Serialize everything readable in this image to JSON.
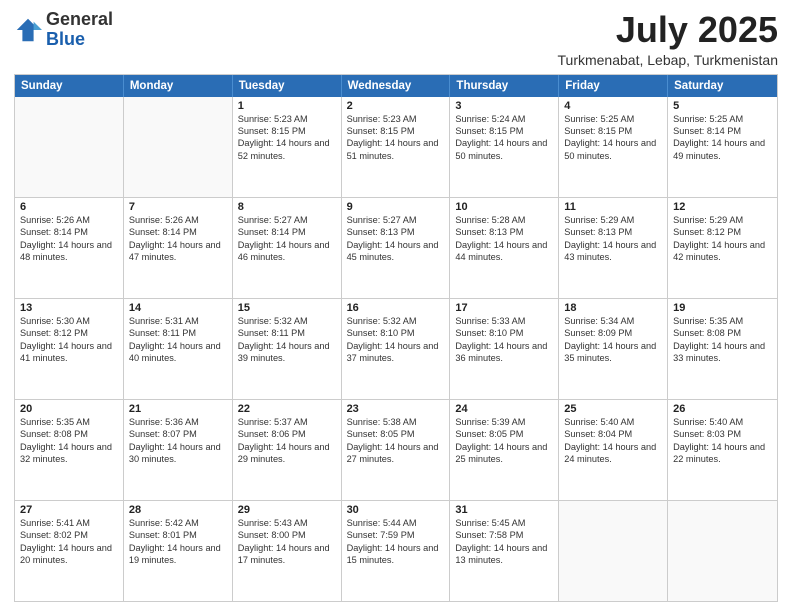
{
  "header": {
    "logo": {
      "general": "General",
      "blue": "Blue"
    },
    "title": "July 2025",
    "location": "Turkmenabat, Lebap, Turkmenistan"
  },
  "calendar": {
    "days": [
      "Sunday",
      "Monday",
      "Tuesday",
      "Wednesday",
      "Thursday",
      "Friday",
      "Saturday"
    ],
    "rows": [
      [
        {
          "day": "",
          "empty": true
        },
        {
          "day": "",
          "empty": true
        },
        {
          "day": "1",
          "sunrise": "Sunrise: 5:23 AM",
          "sunset": "Sunset: 8:15 PM",
          "daylight": "Daylight: 14 hours and 52 minutes."
        },
        {
          "day": "2",
          "sunrise": "Sunrise: 5:23 AM",
          "sunset": "Sunset: 8:15 PM",
          "daylight": "Daylight: 14 hours and 51 minutes."
        },
        {
          "day": "3",
          "sunrise": "Sunrise: 5:24 AM",
          "sunset": "Sunset: 8:15 PM",
          "daylight": "Daylight: 14 hours and 50 minutes."
        },
        {
          "day": "4",
          "sunrise": "Sunrise: 5:25 AM",
          "sunset": "Sunset: 8:15 PM",
          "daylight": "Daylight: 14 hours and 50 minutes."
        },
        {
          "day": "5",
          "sunrise": "Sunrise: 5:25 AM",
          "sunset": "Sunset: 8:14 PM",
          "daylight": "Daylight: 14 hours and 49 minutes."
        }
      ],
      [
        {
          "day": "6",
          "sunrise": "Sunrise: 5:26 AM",
          "sunset": "Sunset: 8:14 PM",
          "daylight": "Daylight: 14 hours and 48 minutes."
        },
        {
          "day": "7",
          "sunrise": "Sunrise: 5:26 AM",
          "sunset": "Sunset: 8:14 PM",
          "daylight": "Daylight: 14 hours and 47 minutes."
        },
        {
          "day": "8",
          "sunrise": "Sunrise: 5:27 AM",
          "sunset": "Sunset: 8:14 PM",
          "daylight": "Daylight: 14 hours and 46 minutes."
        },
        {
          "day": "9",
          "sunrise": "Sunrise: 5:27 AM",
          "sunset": "Sunset: 8:13 PM",
          "daylight": "Daylight: 14 hours and 45 minutes."
        },
        {
          "day": "10",
          "sunrise": "Sunrise: 5:28 AM",
          "sunset": "Sunset: 8:13 PM",
          "daylight": "Daylight: 14 hours and 44 minutes."
        },
        {
          "day": "11",
          "sunrise": "Sunrise: 5:29 AM",
          "sunset": "Sunset: 8:13 PM",
          "daylight": "Daylight: 14 hours and 43 minutes."
        },
        {
          "day": "12",
          "sunrise": "Sunrise: 5:29 AM",
          "sunset": "Sunset: 8:12 PM",
          "daylight": "Daylight: 14 hours and 42 minutes."
        }
      ],
      [
        {
          "day": "13",
          "sunrise": "Sunrise: 5:30 AM",
          "sunset": "Sunset: 8:12 PM",
          "daylight": "Daylight: 14 hours and 41 minutes."
        },
        {
          "day": "14",
          "sunrise": "Sunrise: 5:31 AM",
          "sunset": "Sunset: 8:11 PM",
          "daylight": "Daylight: 14 hours and 40 minutes."
        },
        {
          "day": "15",
          "sunrise": "Sunrise: 5:32 AM",
          "sunset": "Sunset: 8:11 PM",
          "daylight": "Daylight: 14 hours and 39 minutes."
        },
        {
          "day": "16",
          "sunrise": "Sunrise: 5:32 AM",
          "sunset": "Sunset: 8:10 PM",
          "daylight": "Daylight: 14 hours and 37 minutes."
        },
        {
          "day": "17",
          "sunrise": "Sunrise: 5:33 AM",
          "sunset": "Sunset: 8:10 PM",
          "daylight": "Daylight: 14 hours and 36 minutes."
        },
        {
          "day": "18",
          "sunrise": "Sunrise: 5:34 AM",
          "sunset": "Sunset: 8:09 PM",
          "daylight": "Daylight: 14 hours and 35 minutes."
        },
        {
          "day": "19",
          "sunrise": "Sunrise: 5:35 AM",
          "sunset": "Sunset: 8:08 PM",
          "daylight": "Daylight: 14 hours and 33 minutes."
        }
      ],
      [
        {
          "day": "20",
          "sunrise": "Sunrise: 5:35 AM",
          "sunset": "Sunset: 8:08 PM",
          "daylight": "Daylight: 14 hours and 32 minutes."
        },
        {
          "day": "21",
          "sunrise": "Sunrise: 5:36 AM",
          "sunset": "Sunset: 8:07 PM",
          "daylight": "Daylight: 14 hours and 30 minutes."
        },
        {
          "day": "22",
          "sunrise": "Sunrise: 5:37 AM",
          "sunset": "Sunset: 8:06 PM",
          "daylight": "Daylight: 14 hours and 29 minutes."
        },
        {
          "day": "23",
          "sunrise": "Sunrise: 5:38 AM",
          "sunset": "Sunset: 8:05 PM",
          "daylight": "Daylight: 14 hours and 27 minutes."
        },
        {
          "day": "24",
          "sunrise": "Sunrise: 5:39 AM",
          "sunset": "Sunset: 8:05 PM",
          "daylight": "Daylight: 14 hours and 25 minutes."
        },
        {
          "day": "25",
          "sunrise": "Sunrise: 5:40 AM",
          "sunset": "Sunset: 8:04 PM",
          "daylight": "Daylight: 14 hours and 24 minutes."
        },
        {
          "day": "26",
          "sunrise": "Sunrise: 5:40 AM",
          "sunset": "Sunset: 8:03 PM",
          "daylight": "Daylight: 14 hours and 22 minutes."
        }
      ],
      [
        {
          "day": "27",
          "sunrise": "Sunrise: 5:41 AM",
          "sunset": "Sunset: 8:02 PM",
          "daylight": "Daylight: 14 hours and 20 minutes."
        },
        {
          "day": "28",
          "sunrise": "Sunrise: 5:42 AM",
          "sunset": "Sunset: 8:01 PM",
          "daylight": "Daylight: 14 hours and 19 minutes."
        },
        {
          "day": "29",
          "sunrise": "Sunrise: 5:43 AM",
          "sunset": "Sunset: 8:00 PM",
          "daylight": "Daylight: 14 hours and 17 minutes."
        },
        {
          "day": "30",
          "sunrise": "Sunrise: 5:44 AM",
          "sunset": "Sunset: 7:59 PM",
          "daylight": "Daylight: 14 hours and 15 minutes."
        },
        {
          "day": "31",
          "sunrise": "Sunrise: 5:45 AM",
          "sunset": "Sunset: 7:58 PM",
          "daylight": "Daylight: 14 hours and 13 minutes."
        },
        {
          "day": "",
          "empty": true
        },
        {
          "day": "",
          "empty": true
        }
      ]
    ]
  }
}
